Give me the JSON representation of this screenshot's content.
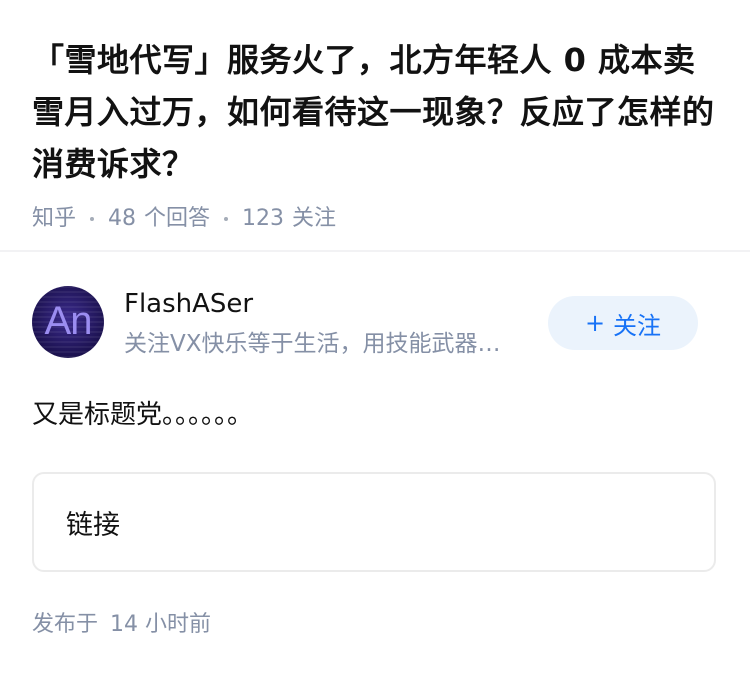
{
  "question": {
    "title": "「雪地代写」服务火了，北方年轻人 0 成本卖雪月入过万，如何看待这一现象？反应了怎样的消费诉求？",
    "source": "知乎",
    "answer_count": "48",
    "answer_label": "个回答",
    "follower_count": "123",
    "follower_label": "关注"
  },
  "answer": {
    "author": {
      "name": "FlashASer",
      "bio": "关注VX快乐等于生活，用技能武器，主宰生活",
      "avatar_text": "An"
    },
    "follow_button": {
      "icon": "+",
      "label": "关注"
    },
    "content": "又是标题党。。。。。。",
    "link_card_label": "链接",
    "published_label": "发布于",
    "published_time": "14 小时前"
  },
  "colors": {
    "primary_text": "#121212",
    "secondary_text": "#8590a6",
    "accent_blue": "#1772f6",
    "follow_bg": "#ebf3fc",
    "avatar_bg": "#1c1250"
  }
}
